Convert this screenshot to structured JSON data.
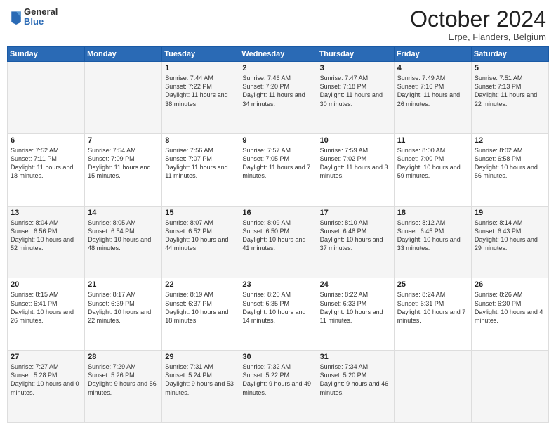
{
  "header": {
    "logo": {
      "general": "General",
      "blue": "Blue"
    },
    "title": "October 2024",
    "location": "Erpe, Flanders, Belgium"
  },
  "days_of_week": [
    "Sunday",
    "Monday",
    "Tuesday",
    "Wednesday",
    "Thursday",
    "Friday",
    "Saturday"
  ],
  "weeks": [
    [
      {
        "day": "",
        "sunrise": "",
        "sunset": "",
        "daylight": ""
      },
      {
        "day": "",
        "sunrise": "",
        "sunset": "",
        "daylight": ""
      },
      {
        "day": "1",
        "sunrise": "Sunrise: 7:44 AM",
        "sunset": "Sunset: 7:22 PM",
        "daylight": "Daylight: 11 hours and 38 minutes."
      },
      {
        "day": "2",
        "sunrise": "Sunrise: 7:46 AM",
        "sunset": "Sunset: 7:20 PM",
        "daylight": "Daylight: 11 hours and 34 minutes."
      },
      {
        "day": "3",
        "sunrise": "Sunrise: 7:47 AM",
        "sunset": "Sunset: 7:18 PM",
        "daylight": "Daylight: 11 hours and 30 minutes."
      },
      {
        "day": "4",
        "sunrise": "Sunrise: 7:49 AM",
        "sunset": "Sunset: 7:16 PM",
        "daylight": "Daylight: 11 hours and 26 minutes."
      },
      {
        "day": "5",
        "sunrise": "Sunrise: 7:51 AM",
        "sunset": "Sunset: 7:13 PM",
        "daylight": "Daylight: 11 hours and 22 minutes."
      }
    ],
    [
      {
        "day": "6",
        "sunrise": "Sunrise: 7:52 AM",
        "sunset": "Sunset: 7:11 PM",
        "daylight": "Daylight: 11 hours and 18 minutes."
      },
      {
        "day": "7",
        "sunrise": "Sunrise: 7:54 AM",
        "sunset": "Sunset: 7:09 PM",
        "daylight": "Daylight: 11 hours and 15 minutes."
      },
      {
        "day": "8",
        "sunrise": "Sunrise: 7:56 AM",
        "sunset": "Sunset: 7:07 PM",
        "daylight": "Daylight: 11 hours and 11 minutes."
      },
      {
        "day": "9",
        "sunrise": "Sunrise: 7:57 AM",
        "sunset": "Sunset: 7:05 PM",
        "daylight": "Daylight: 11 hours and 7 minutes."
      },
      {
        "day": "10",
        "sunrise": "Sunrise: 7:59 AM",
        "sunset": "Sunset: 7:02 PM",
        "daylight": "Daylight: 11 hours and 3 minutes."
      },
      {
        "day": "11",
        "sunrise": "Sunrise: 8:00 AM",
        "sunset": "Sunset: 7:00 PM",
        "daylight": "Daylight: 10 hours and 59 minutes."
      },
      {
        "day": "12",
        "sunrise": "Sunrise: 8:02 AM",
        "sunset": "Sunset: 6:58 PM",
        "daylight": "Daylight: 10 hours and 56 minutes."
      }
    ],
    [
      {
        "day": "13",
        "sunrise": "Sunrise: 8:04 AM",
        "sunset": "Sunset: 6:56 PM",
        "daylight": "Daylight: 10 hours and 52 minutes."
      },
      {
        "day": "14",
        "sunrise": "Sunrise: 8:05 AM",
        "sunset": "Sunset: 6:54 PM",
        "daylight": "Daylight: 10 hours and 48 minutes."
      },
      {
        "day": "15",
        "sunrise": "Sunrise: 8:07 AM",
        "sunset": "Sunset: 6:52 PM",
        "daylight": "Daylight: 10 hours and 44 minutes."
      },
      {
        "day": "16",
        "sunrise": "Sunrise: 8:09 AM",
        "sunset": "Sunset: 6:50 PM",
        "daylight": "Daylight: 10 hours and 41 minutes."
      },
      {
        "day": "17",
        "sunrise": "Sunrise: 8:10 AM",
        "sunset": "Sunset: 6:48 PM",
        "daylight": "Daylight: 10 hours and 37 minutes."
      },
      {
        "day": "18",
        "sunrise": "Sunrise: 8:12 AM",
        "sunset": "Sunset: 6:45 PM",
        "daylight": "Daylight: 10 hours and 33 minutes."
      },
      {
        "day": "19",
        "sunrise": "Sunrise: 8:14 AM",
        "sunset": "Sunset: 6:43 PM",
        "daylight": "Daylight: 10 hours and 29 minutes."
      }
    ],
    [
      {
        "day": "20",
        "sunrise": "Sunrise: 8:15 AM",
        "sunset": "Sunset: 6:41 PM",
        "daylight": "Daylight: 10 hours and 26 minutes."
      },
      {
        "day": "21",
        "sunrise": "Sunrise: 8:17 AM",
        "sunset": "Sunset: 6:39 PM",
        "daylight": "Daylight: 10 hours and 22 minutes."
      },
      {
        "day": "22",
        "sunrise": "Sunrise: 8:19 AM",
        "sunset": "Sunset: 6:37 PM",
        "daylight": "Daylight: 10 hours and 18 minutes."
      },
      {
        "day": "23",
        "sunrise": "Sunrise: 8:20 AM",
        "sunset": "Sunset: 6:35 PM",
        "daylight": "Daylight: 10 hours and 14 minutes."
      },
      {
        "day": "24",
        "sunrise": "Sunrise: 8:22 AM",
        "sunset": "Sunset: 6:33 PM",
        "daylight": "Daylight: 10 hours and 11 minutes."
      },
      {
        "day": "25",
        "sunrise": "Sunrise: 8:24 AM",
        "sunset": "Sunset: 6:31 PM",
        "daylight": "Daylight: 10 hours and 7 minutes."
      },
      {
        "day": "26",
        "sunrise": "Sunrise: 8:26 AM",
        "sunset": "Sunset: 6:30 PM",
        "daylight": "Daylight: 10 hours and 4 minutes."
      }
    ],
    [
      {
        "day": "27",
        "sunrise": "Sunrise: 7:27 AM",
        "sunset": "Sunset: 5:28 PM",
        "daylight": "Daylight: 10 hours and 0 minutes."
      },
      {
        "day": "28",
        "sunrise": "Sunrise: 7:29 AM",
        "sunset": "Sunset: 5:26 PM",
        "daylight": "Daylight: 9 hours and 56 minutes."
      },
      {
        "day": "29",
        "sunrise": "Sunrise: 7:31 AM",
        "sunset": "Sunset: 5:24 PM",
        "daylight": "Daylight: 9 hours and 53 minutes."
      },
      {
        "day": "30",
        "sunrise": "Sunrise: 7:32 AM",
        "sunset": "Sunset: 5:22 PM",
        "daylight": "Daylight: 9 hours and 49 minutes."
      },
      {
        "day": "31",
        "sunrise": "Sunrise: 7:34 AM",
        "sunset": "Sunset: 5:20 PM",
        "daylight": "Daylight: 9 hours and 46 minutes."
      },
      {
        "day": "",
        "sunrise": "",
        "sunset": "",
        "daylight": ""
      },
      {
        "day": "",
        "sunrise": "",
        "sunset": "",
        "daylight": ""
      }
    ]
  ]
}
